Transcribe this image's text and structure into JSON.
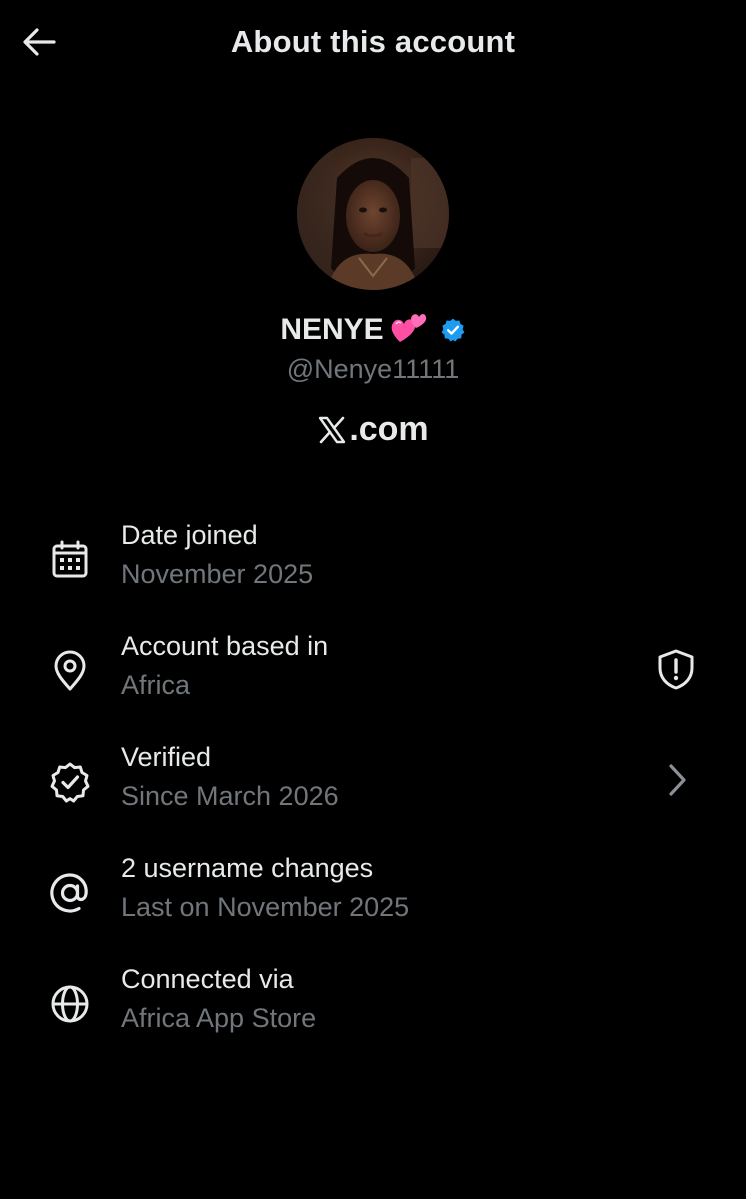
{
  "header": {
    "title": "About this account",
    "back_icon": "arrow-left-icon"
  },
  "profile": {
    "display_name": "NENYE",
    "name_emoji": "💕",
    "verified": true,
    "handle": "@Nenye11111",
    "site": ".com"
  },
  "details": [
    {
      "label": "Date joined",
      "value": "November 2025",
      "icon": "calendar-icon"
    },
    {
      "label": "Account based in",
      "value": "Africa",
      "icon": "location-pin-icon",
      "trailing_icon": "shield-alert-icon"
    },
    {
      "label": "Verified",
      "value": "Since March 2026",
      "icon": "verified-badge-icon",
      "trailing_icon": "chevron-right-icon"
    },
    {
      "label": "2 username changes",
      "value": "Last on November 2025",
      "icon": "at-sign-icon"
    },
    {
      "label": "Connected via",
      "value": "Africa App Store",
      "icon": "globe-icon"
    }
  ],
  "colors": {
    "background": "#000000",
    "primary_text": "#e7e9ea",
    "secondary_text": "#71767b",
    "verified_blue": "#1d9bf0",
    "emoji_pink": "#ff4fa3"
  }
}
